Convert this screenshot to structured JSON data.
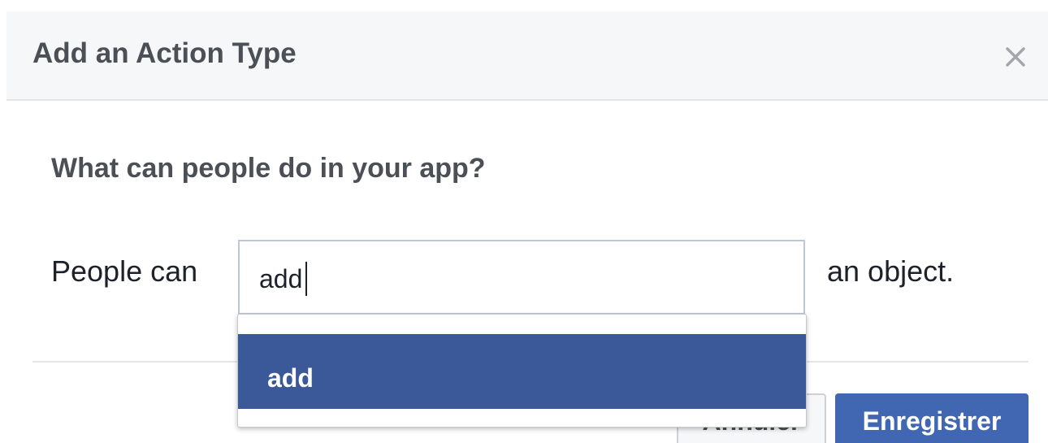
{
  "dialog": {
    "title": "Add an Action Type",
    "close_icon": "close-icon"
  },
  "form": {
    "question": "What can people do in your app?",
    "prefix_label": "People can",
    "suffix_label": "an object.",
    "action_input": {
      "value": "add",
      "placeholder": ""
    }
  },
  "autocomplete": {
    "items": [
      {
        "label": "add",
        "selected": true
      }
    ]
  },
  "footer": {
    "cancel_label": "Annuler",
    "save_label": "Enregistrer"
  },
  "colors": {
    "header_bg": "#f6f7f9",
    "title_text": "#4b4f56",
    "primary_button": "#4267b2",
    "selected_item": "#3b5998",
    "input_border": "#bdc7d8"
  }
}
